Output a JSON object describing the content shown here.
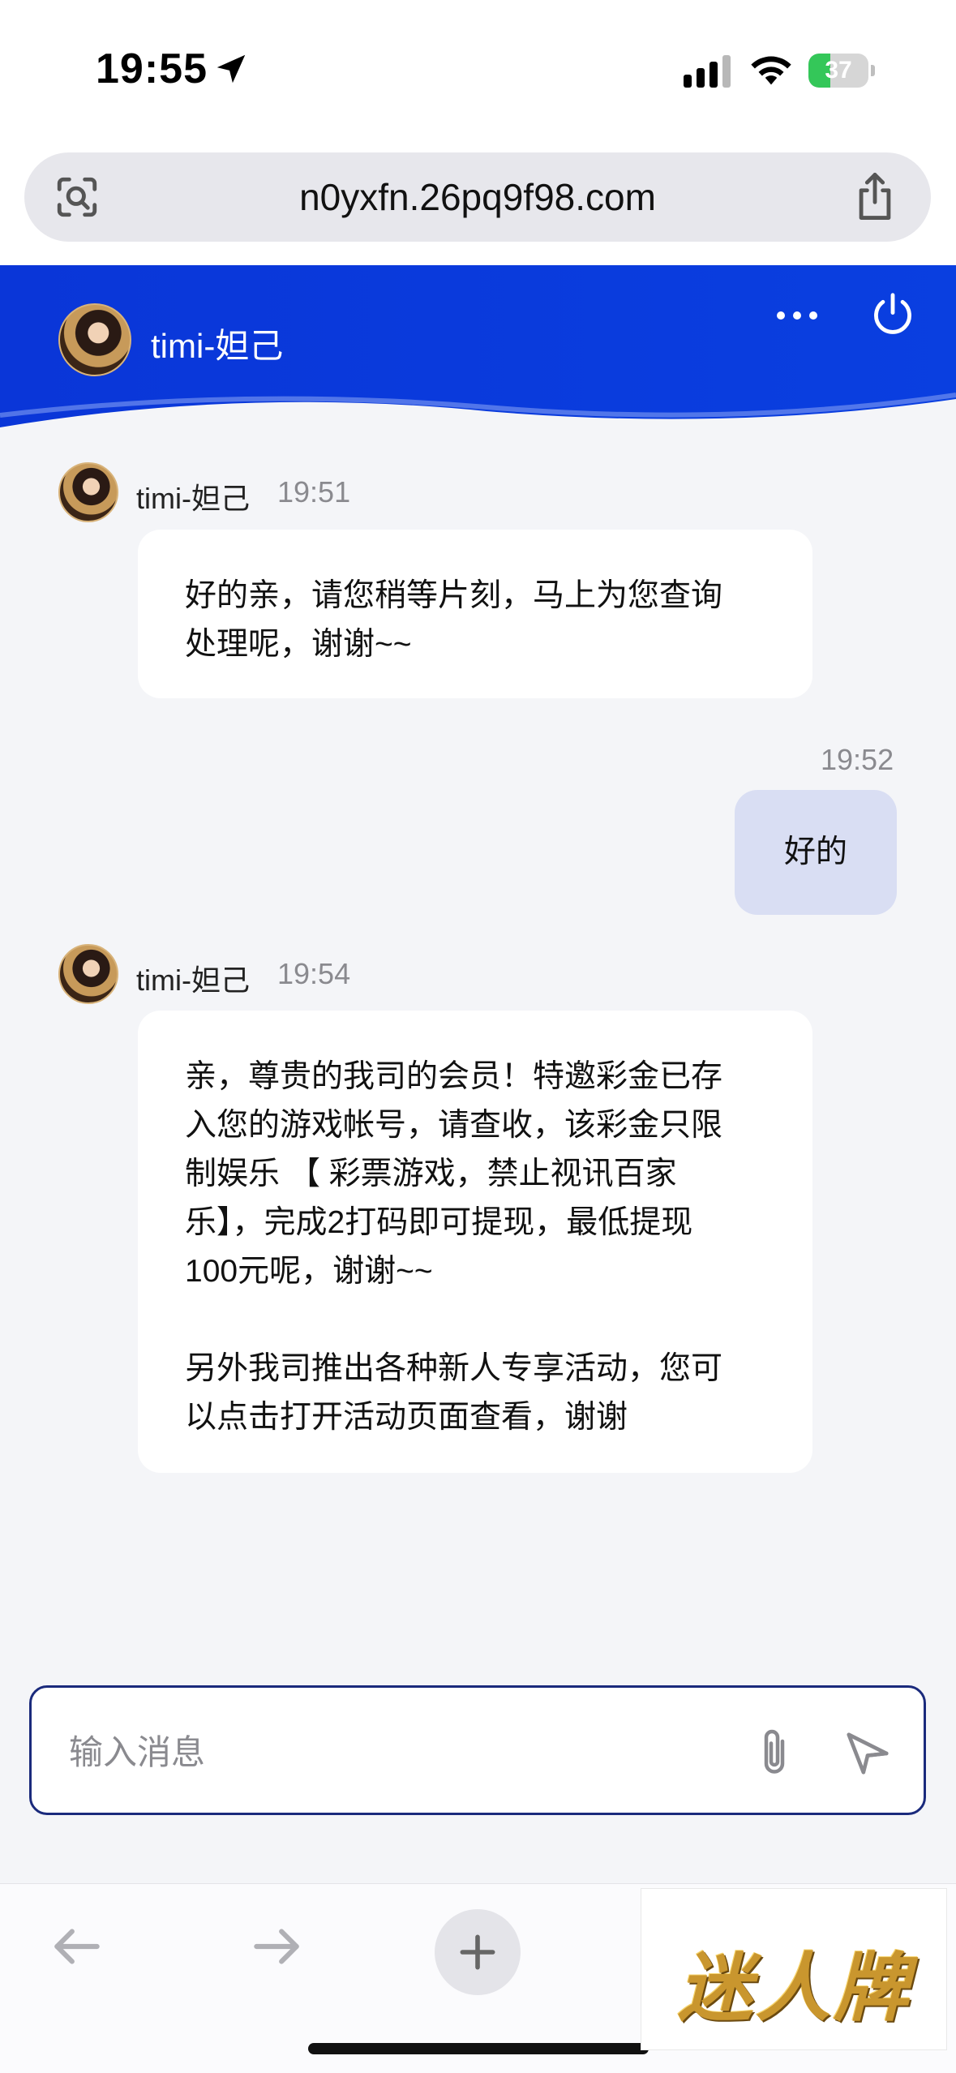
{
  "status_bar": {
    "time": "19:55",
    "battery_level": "37",
    "battery_fraction": 0.37,
    "icons": [
      "location-arrow-icon",
      "cellular-signal-icon",
      "wifi-icon",
      "battery-charging-icon"
    ]
  },
  "browser": {
    "url": "n0yxfn.26pq9f98.com",
    "lens_icon": "visual-lookup-icon",
    "share_icon": "share-icon"
  },
  "chat_header": {
    "agent_name": "timi-妲己",
    "more_icon": "more-icon",
    "power_icon": "power-icon",
    "accent": "#0a3fe0"
  },
  "messages": [
    {
      "direction": "incoming",
      "sender": "timi-妲己",
      "time": "19:51",
      "text": "好的亲，请您稍等片刻，马上为您查询\n处理呢，谢谢~~"
    },
    {
      "direction": "outgoing",
      "time": "19:52",
      "text": "好的"
    },
    {
      "direction": "incoming",
      "sender": "timi-妲己",
      "time": "19:54",
      "text": "亲，尊贵的我司的会员！特邀彩金已存\n入您的游戏帐号，请查收，该彩金只限\n制娱乐 【 彩票游戏，禁止视讯百家\n乐】，完成2打码即可提现，最低提现\n100元呢，谢谢~~\n\n另外我司推出各种新人专享活动，您可\n以点击打开活动页面查看，谢谢"
    }
  ],
  "composer": {
    "placeholder": "输入消息",
    "value": "",
    "attach_icon": "paperclip-icon",
    "send_icon": "send-icon"
  },
  "toolbar": {
    "icons": [
      "back-arrow-icon",
      "forward-arrow-icon",
      "plus-icon"
    ]
  },
  "watermark": {
    "text": "迷人牌"
  },
  "colors": {
    "header_blue": "#0a3fe0",
    "outgoing_bubble": "#d9def3",
    "chat_bg": "#f4f5f8",
    "input_border": "#1a2a7c"
  }
}
